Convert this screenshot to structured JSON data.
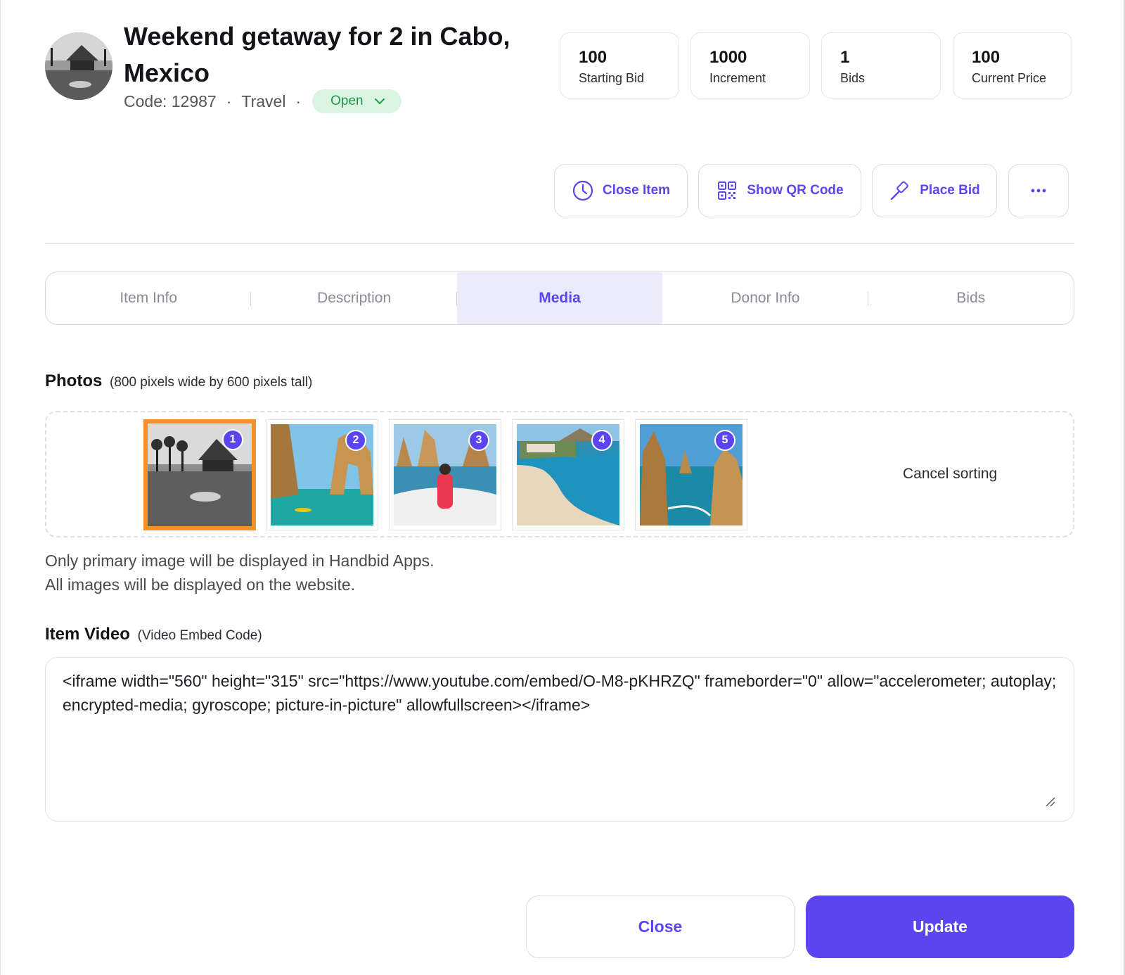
{
  "item": {
    "title": "Weekend getaway for 2 in Cabo, Mexico",
    "code": "Code: 12987",
    "category": "Travel",
    "status": "Open",
    "separator": "·"
  },
  "stats": [
    {
      "value": "100",
      "label": "Starting Bid"
    },
    {
      "value": "1000",
      "label": "Increment"
    },
    {
      "value": "1",
      "label": "Bids"
    },
    {
      "value": "100",
      "label": "Current Price"
    }
  ],
  "actions": {
    "close_item": "Close Item",
    "show_qr": "Show QR Code",
    "place_bid": "Place Bid",
    "more_icon": "more-horizontal-icon"
  },
  "tabs": [
    {
      "label": "Item Info",
      "active": false
    },
    {
      "label": "Description",
      "active": false
    },
    {
      "label": "Media",
      "active": true
    },
    {
      "label": "Donor Info",
      "active": false
    },
    {
      "label": "Bids",
      "active": false
    }
  ],
  "photos": {
    "label": "Photos",
    "sublabel": "(800 pixels wide by 600 pixels tall)",
    "items": [
      {
        "number": "1",
        "primary": true
      },
      {
        "number": "2",
        "primary": false
      },
      {
        "number": "3",
        "primary": false
      },
      {
        "number": "4",
        "primary": false
      },
      {
        "number": "5",
        "primary": false
      }
    ],
    "cancel_sorting": "Cancel sorting",
    "note_line1": "Only primary image will be displayed in Handbid Apps.",
    "note_line2": "All images will be displayed on the website."
  },
  "video": {
    "label": "Item Video",
    "sublabel": "(Video Embed Code)",
    "value": "<iframe width=\"560\" height=\"315\" src=\"https://www.youtube.com/embed/O-M8-pKHRZQ\" frameborder=\"0\" allow=\"accelerometer; autoplay; encrypted-media; gyroscope; picture-in-picture\" allowfullscreen></iframe>"
  },
  "footer": {
    "close": "Close",
    "update": "Update"
  },
  "colors": {
    "accent": "#5b45f0",
    "status_bg": "#dcf5e2",
    "status_text": "#1f9a45",
    "primary_photo_border": "#f4922a"
  }
}
